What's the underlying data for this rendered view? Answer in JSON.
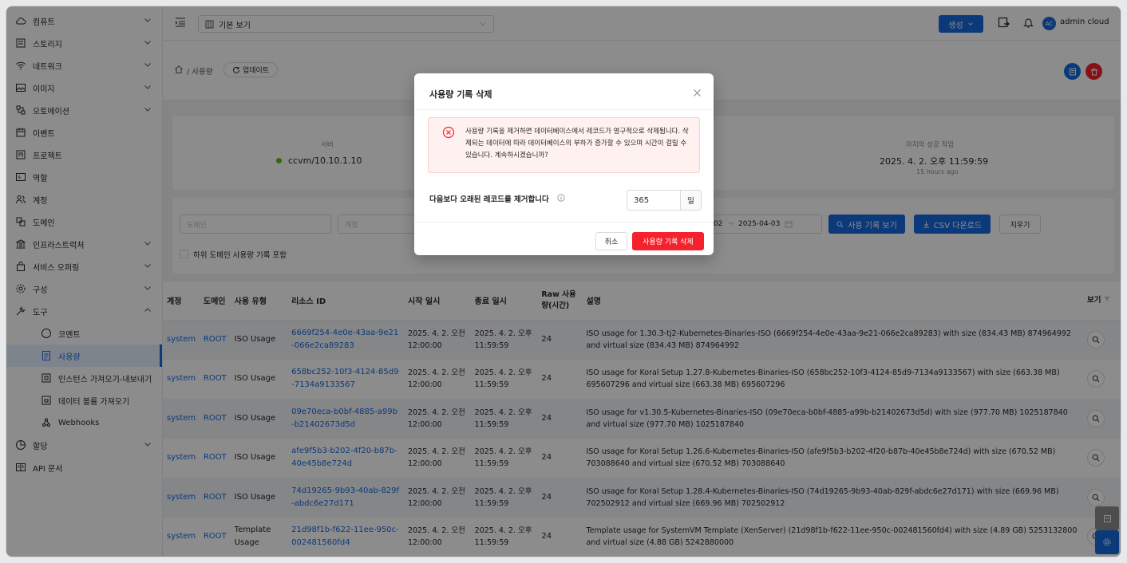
{
  "sidebar": {
    "items": [
      {
        "label": "컴퓨트",
        "icon": "cloud-icon",
        "chevron": "down"
      },
      {
        "label": "스토리지",
        "icon": "storage-icon",
        "chevron": "down"
      },
      {
        "label": "네트워크",
        "icon": "wifi-icon",
        "chevron": "down"
      },
      {
        "label": "이미지",
        "icon": "image-icon",
        "chevron": "down"
      },
      {
        "label": "오토메이션",
        "icon": "automation-icon",
        "chevron": "down"
      },
      {
        "label": "이벤트",
        "icon": "calendar-icon"
      },
      {
        "label": "프로젝트",
        "icon": "project-icon"
      },
      {
        "label": "역할",
        "icon": "role-icon"
      },
      {
        "label": "계정",
        "icon": "team-icon"
      },
      {
        "label": "도메인",
        "icon": "domain-icon"
      },
      {
        "label": "인프라스트럭처",
        "icon": "bank-icon",
        "chevron": "down"
      },
      {
        "label": "서비스 오퍼링",
        "icon": "shopping-icon",
        "chevron": "down"
      },
      {
        "label": "구성",
        "icon": "gear-icon",
        "chevron": "down"
      },
      {
        "label": "도구",
        "icon": "tool-icon",
        "chevron": "up"
      }
    ],
    "tool_items": [
      {
        "label": "코멘트",
        "icon": "comment-icon"
      },
      {
        "label": "사용량",
        "icon": "usage-icon",
        "active": true
      },
      {
        "label": "인스턴스 가져오기-내보내기",
        "icon": "import-icon"
      },
      {
        "label": "데이터 볼륨 가져오기",
        "icon": "volume-import-icon"
      },
      {
        "label": "Webhooks",
        "icon": "webhook-icon"
      }
    ],
    "bottom_items": [
      {
        "label": "할당",
        "icon": "quota-icon",
        "chevron": "down"
      },
      {
        "label": "API 문서",
        "icon": "api-doc-icon"
      }
    ]
  },
  "topbar": {
    "view_label": "기본 보기",
    "create_label": "생성",
    "user_initials": "AC",
    "user_name": "admin cloud"
  },
  "breadcrumb": {
    "path": "/ 사용량",
    "refresh_label": "업데이트"
  },
  "summary": {
    "server_label": "서버",
    "server_value": "ccvm/10.10.1.10",
    "last_job_label": "마지막 성공 작업",
    "last_job_value": "2025. 4. 2. 오후 11:59:59",
    "last_job_relative": "15 hours ago"
  },
  "filters": {
    "domain_placeholder": "도메인",
    "account_placeholder": "계정",
    "date_range_partial": "02",
    "date_arrow": "→",
    "date_end": "2025-04-03",
    "view_records_label": "사용 기록 보기",
    "csv_label": "CSV 다운로드",
    "clear_label": "지우기",
    "subdomain_label": "하위 도메인 사용량 기록 포함"
  },
  "table": {
    "headers": [
      "계정",
      "도메인",
      "사용 유형",
      "리소스 ID",
      "시작 일시",
      "종료 일시",
      "Raw 사용량(시간)",
      "설명",
      "보기"
    ],
    "rows": [
      {
        "account": "system",
        "domain": "ROOT",
        "type": "ISO Usage",
        "resource_id": "6669f254-4e0e-43aa-9e21-066e2ca89283",
        "start": "2025. 4. 2. 오전 12:00:00",
        "end": "2025. 4. 2. 오후 11:59:59",
        "raw": "24",
        "desc": "ISO usage for 1.30.3-tj2-Kubernetes-Binaries-ISO (6669f254-4e0e-43aa-9e21-066e2ca89283) with size (834.43 MB) 874964992 and virtual size (834.43 MB) 874964992"
      },
      {
        "account": "system",
        "domain": "ROOT",
        "type": "ISO Usage",
        "resource_id": "658bc252-10f3-4124-85d9-7134a9133567",
        "start": "2025. 4. 2. 오전 12:00:00",
        "end": "2025. 4. 2. 오후 11:59:59",
        "raw": "24",
        "desc": "ISO usage for Koral Setup 1.27.8-Kubernetes-Binaries-ISO (658bc252-10f3-4124-85d9-7134a9133567) with size (663.38 MB) 695607296 and virtual size (663.38 MB) 695607296"
      },
      {
        "account": "system",
        "domain": "ROOT",
        "type": "ISO Usage",
        "resource_id": "09e70eca-b0bf-4885-a99b-b21402673d5d",
        "start": "2025. 4. 2. 오전 12:00:00",
        "end": "2025. 4. 2. 오후 11:59:59",
        "raw": "24",
        "desc": "ISO usage for v1.30.5-Kubernetes-Binaries-ISO (09e70eca-b0bf-4885-a99b-b21402673d5d) with size (977.70 MB) 1025187840 and virtual size (977.70 MB) 1025187840"
      },
      {
        "account": "system",
        "domain": "ROOT",
        "type": "ISO Usage",
        "resource_id": "afe9f5b3-b202-4f20-b87b-40e45b8e724d",
        "start": "2025. 4. 2. 오전 12:00:00",
        "end": "2025. 4. 2. 오후 11:59:59",
        "raw": "24",
        "desc": "ISO usage for Koral Setup 1.26.6-Kubernetes-Binaries-ISO (afe9f5b3-b202-4f20-b87b-40e45b8e724d) with size (670.52 MB) 703088640 and virtual size (670.52 MB) 703088640"
      },
      {
        "account": "system",
        "domain": "ROOT",
        "type": "ISO Usage",
        "resource_id": "74d19265-9b93-40ab-829f-abdc6e27d171",
        "start": "2025. 4. 2. 오전 12:00:00",
        "end": "2025. 4. 2. 오후 11:59:59",
        "raw": "24",
        "desc": "ISO usage for Koral Setup 1.28.4-Kubernetes-Binaries-ISO (74d19265-9b93-40ab-829f-abdc6e27d171) with size (669.96 MB) 702502912 and virtual size (669.96 MB) 702502912"
      },
      {
        "account": "system",
        "domain": "ROOT",
        "type": "Template Usage",
        "resource_id": "21d98f1b-f622-11ee-950c-002481560fd4",
        "start": "2025. 4. 2. 오전 12:00:00",
        "end": "2025. 4. 2. 오후 11:59:59",
        "raw": "24",
        "desc": "Template usage for SystemVM Template (XenServer) (21d98f1b-f622-11ee-950c-002481560fd4) with size (4.89 GB) 5253132800 and virtual size (4.88 GB) 5242880000"
      }
    ]
  },
  "modal": {
    "title": "사용량 기록 삭제",
    "alert_text": "사용량 기록을 제거하면 데이터베이스에서 레코드가 영구적으로 삭제됩니다. 삭제되는 데이터에 따라 데이터베이스의 부하가 증가할 수 있으며 시간이 걸릴 수 있습니다. 계속하시겠습니까?",
    "days_label": "다음보다 오래된 레코드를 제거합니다",
    "days_value": "365",
    "days_unit": "일",
    "cancel_label": "취소",
    "confirm_label": "사용량 기록 삭제"
  },
  "colors": {
    "primary": "#1668dc",
    "danger": "#f5222d",
    "online": "#52c41a"
  }
}
